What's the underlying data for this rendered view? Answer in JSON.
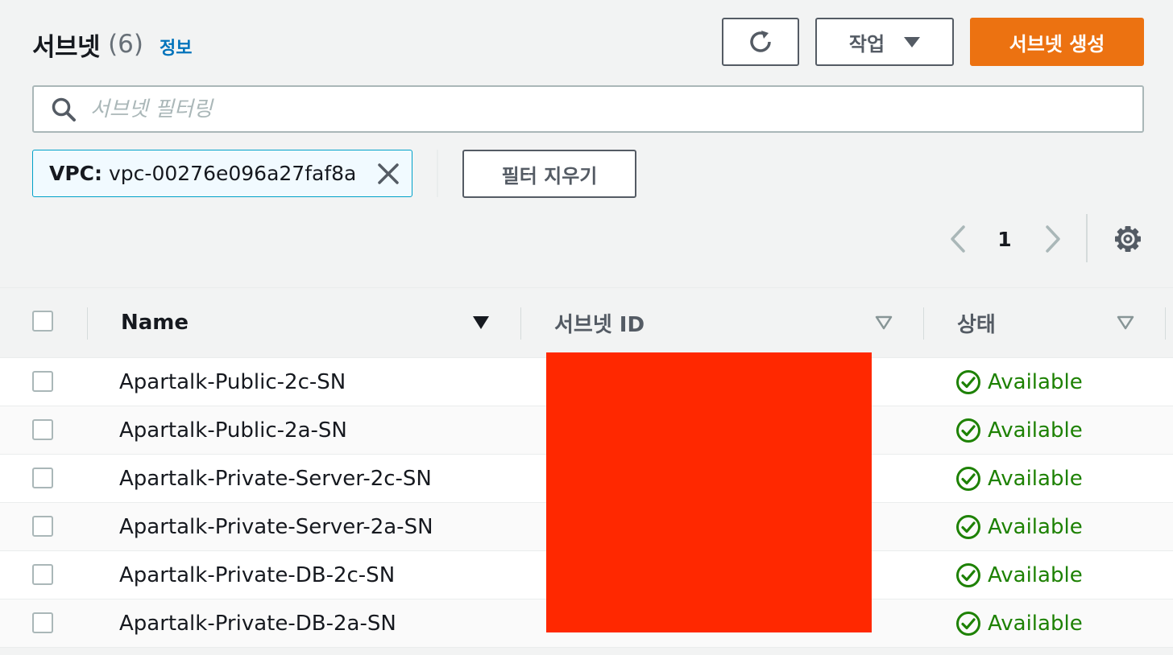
{
  "header": {
    "title": "서브넷",
    "count": "(6)",
    "info_link": "정보"
  },
  "toolbar": {
    "refresh_icon": "refresh-icon",
    "actions_label": "작업",
    "create_label": "서브넷 생성"
  },
  "search": {
    "placeholder": "서브넷 필터링",
    "value": ""
  },
  "filter_token": {
    "key": "VPC:",
    "value": "vpc-00276e096a27faf8a"
  },
  "clear_filters_label": "필터 지우기",
  "pagination": {
    "current_page": "1"
  },
  "table": {
    "columns": {
      "name": "Name",
      "subnet_id": "서브넷 ID",
      "status": "상태"
    },
    "rows": [
      {
        "name": "Apartalk-Public-2c-SN",
        "status": "Available"
      },
      {
        "name": "Apartalk-Public-2a-SN",
        "status": "Available"
      },
      {
        "name": "Apartalk-Private-Server-2c-SN",
        "status": "Available"
      },
      {
        "name": "Apartalk-Private-Server-2a-SN",
        "status": "Available"
      },
      {
        "name": "Apartalk-Private-DB-2c-SN",
        "status": "Available"
      },
      {
        "name": "Apartalk-Private-DB-2a-SN",
        "status": "Available"
      }
    ]
  },
  "colors": {
    "primary": "#ec7211",
    "link": "#0073bb",
    "success": "#1d8102",
    "redaction": "#ff2800"
  }
}
